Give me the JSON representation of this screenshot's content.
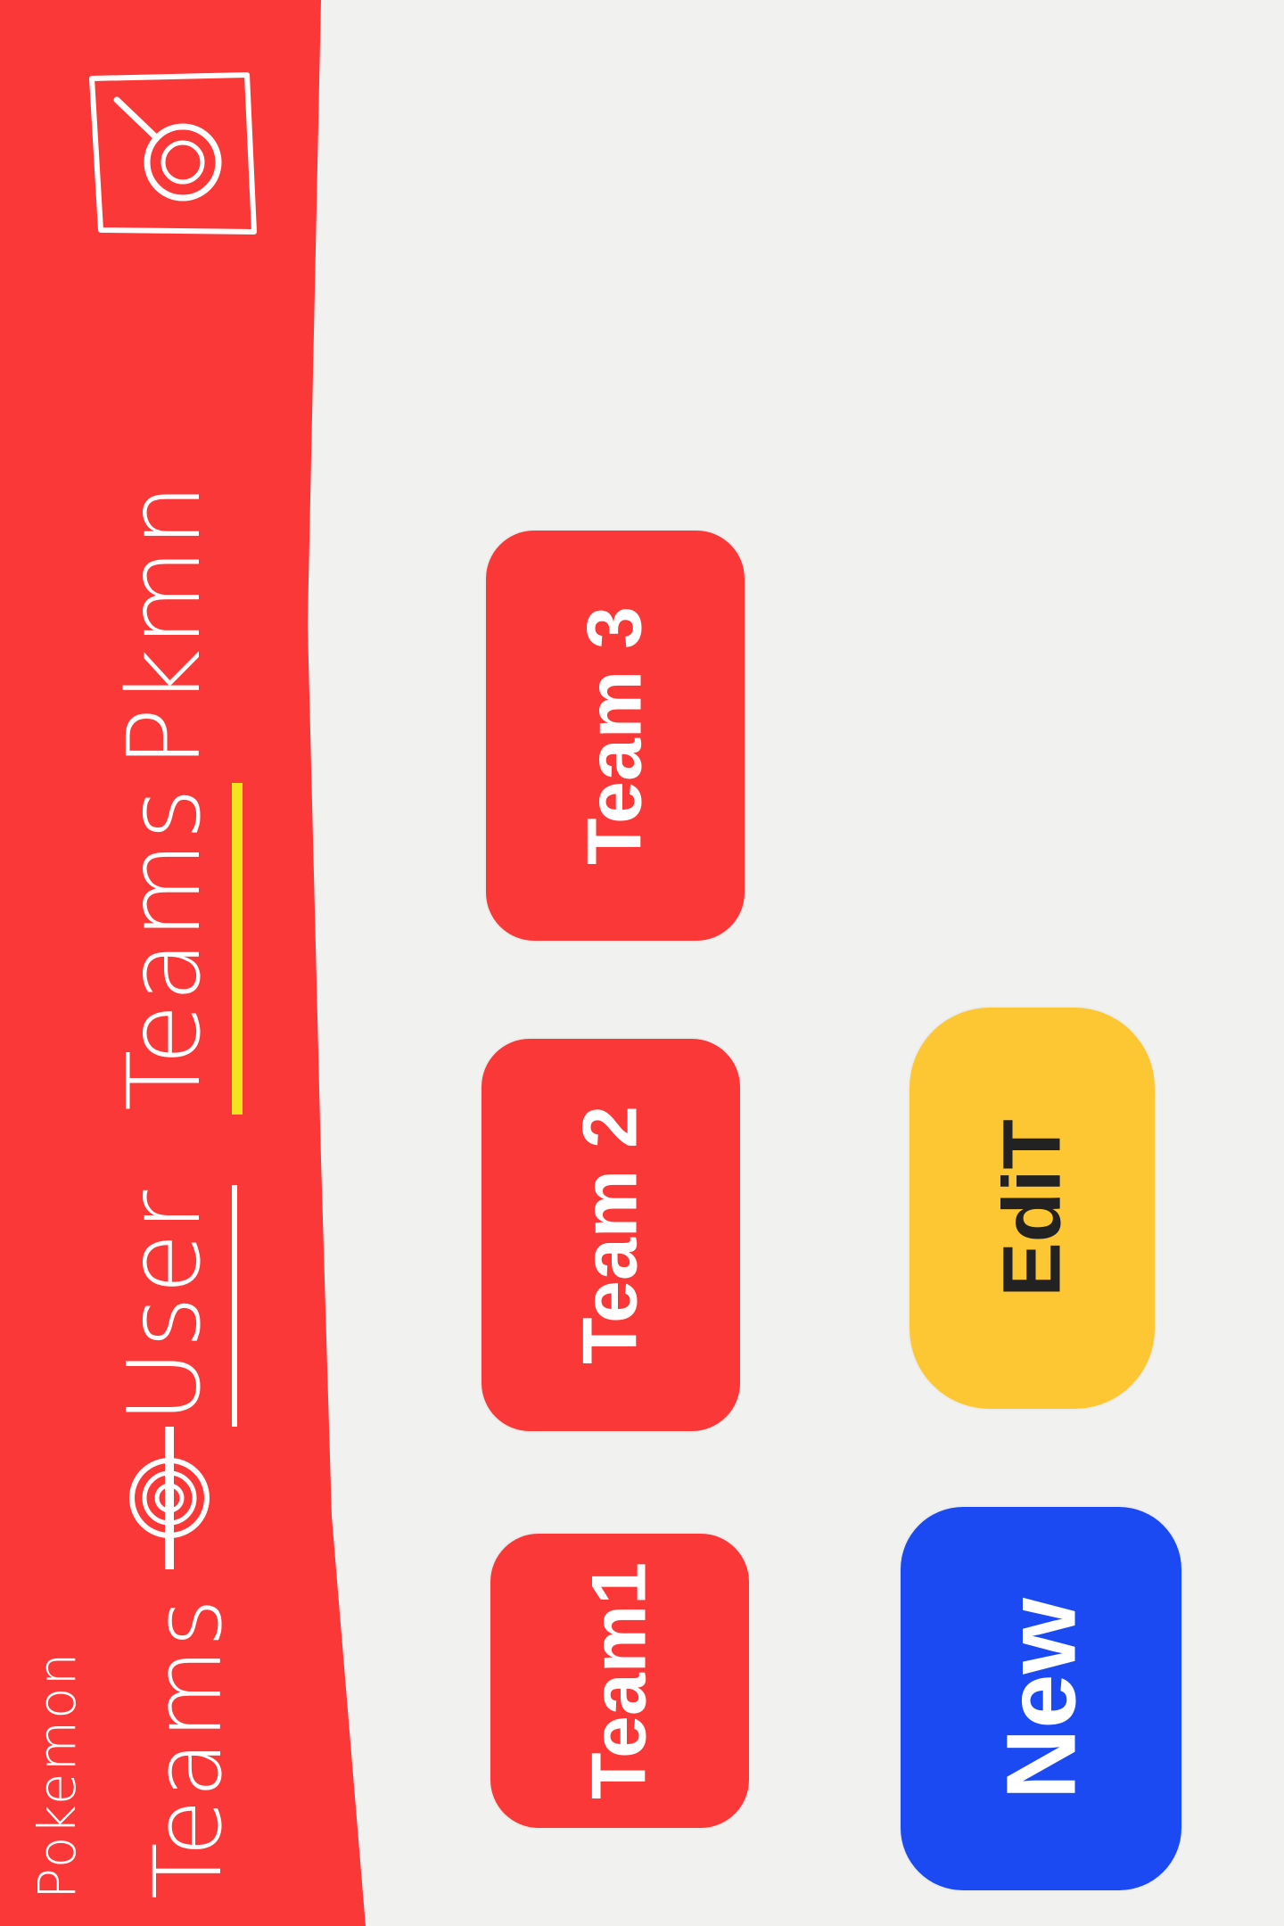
{
  "header": {
    "app_title_line1": "Pokemon",
    "app_title_line2": "Teams",
    "logo_icon": "pokeball-icon",
    "nav_tabs": [
      {
        "label": "User",
        "active": false
      },
      {
        "label": "Teams",
        "active": true
      },
      {
        "label": "Pkmn",
        "active": false
      }
    ],
    "search_icon": "search-icon"
  },
  "main": {
    "teams": [
      {
        "label": "Team1"
      },
      {
        "label": "Team 2"
      },
      {
        "label": "Team 3"
      }
    ],
    "actions": {
      "edit_label": "EdiT",
      "new_label": "New"
    }
  },
  "colors": {
    "header_bg": "#fa3838",
    "team_tile": "#fa3838",
    "active_tab_underline": "#f2e51f",
    "edit_button": "#fcc733",
    "new_button": "#1b4af2",
    "background": "#f1f1ef"
  }
}
